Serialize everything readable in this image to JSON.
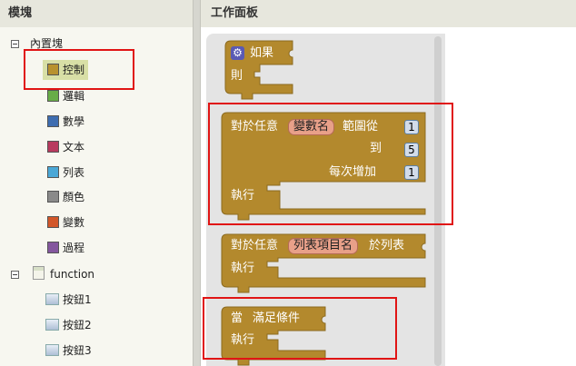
{
  "left_panel": {
    "header": "模塊",
    "builtin": {
      "label": "內置塊",
      "items": [
        {
          "label": "控制",
          "color": "#b8912e",
          "selected": true
        },
        {
          "label": "邏輯",
          "color": "#68ad47"
        },
        {
          "label": "數學",
          "color": "#3e6db0"
        },
        {
          "label": "文本",
          "color": "#b83a5f"
        },
        {
          "label": "列表",
          "color": "#4aa7d6"
        },
        {
          "label": "顏色",
          "color": "#8a8a8a"
        },
        {
          "label": "變數",
          "color": "#d2572a"
        },
        {
          "label": "過程",
          "color": "#84579e"
        }
      ]
    },
    "function": {
      "label": "function",
      "items": [
        {
          "label": "按鈕1"
        },
        {
          "label": "按鈕2"
        },
        {
          "label": "按鈕3"
        }
      ]
    }
  },
  "workspace": {
    "header": "工作面板",
    "block_color": "#b3892d",
    "blocks": {
      "if_block": {
        "if_label": "如果",
        "then_label": "則",
        "icon": "gear-icon"
      },
      "for_range": {
        "title": "對於任意",
        "var": "變數名",
        "range_from": "範圍從",
        "to": "到",
        "step": "每次增加",
        "do_label": "執行",
        "from_value": "1",
        "to_value": "5",
        "step_value": "1"
      },
      "for_each": {
        "title": "對於任意",
        "var": "列表項目名",
        "in_list": "於列表",
        "do_label": "執行"
      },
      "while": {
        "title": "當",
        "condition": "滿足條件",
        "do_label": "執行"
      }
    }
  }
}
